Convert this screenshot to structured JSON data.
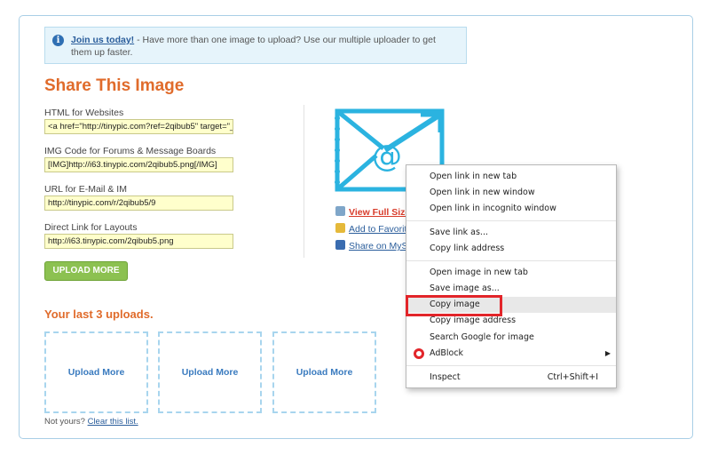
{
  "notice": {
    "link": "Join us today!",
    "text": " - Have more than one image to upload? Use our multiple uploader to get them up faster."
  },
  "share": {
    "title": "Share This Image",
    "fields": [
      {
        "label": "HTML for Websites",
        "value": "<a href=\"http://tinypic.com?ref=2qibub5\" target=\"_"
      },
      {
        "label": "IMG Code for Forums & Message Boards",
        "value": "[IMG]http://i63.tinypic.com/2qibub5.png[/IMG]"
      },
      {
        "label": "URL for E-Mail & IM",
        "value": "http://tinypic.com/r/2qibub5/9"
      },
      {
        "label": "Direct Link for Layouts",
        "value": "http://i63.tinypic.com/2qibub5.png"
      }
    ],
    "upload_button": "UPLOAD MORE"
  },
  "links": {
    "view_full": "View Full Size",
    "add_favorites": "Add to Favorite",
    "share_myspace": "Share on MySp"
  },
  "recent": {
    "title": "Your last 3 uploads.",
    "boxes": [
      "Upload More",
      "Upload More",
      "Upload More"
    ],
    "not_yours": "Not yours?",
    "clear_list": "Clear this list."
  },
  "context_menu": {
    "items": [
      {
        "label": "Open link in new tab"
      },
      {
        "label": "Open link in new window"
      },
      {
        "label": "Open link in incognito window"
      },
      {
        "label": "Save link as..."
      },
      {
        "label": "Copy link address"
      },
      {
        "label": "Open image in new tab"
      },
      {
        "label": "Save image as..."
      },
      {
        "label": "Copy image"
      },
      {
        "label": "Copy image address"
      },
      {
        "label": "Search Google for image"
      },
      {
        "label": "AdBlock"
      },
      {
        "label": "Inspect",
        "shortcut": "Ctrl+Shift+I"
      }
    ]
  },
  "colors": {
    "accent_orange": "#e06b2b",
    "link_blue": "#2a5d9b",
    "highlight_red": "#e2252a",
    "field_yellow": "#ffffcc"
  }
}
